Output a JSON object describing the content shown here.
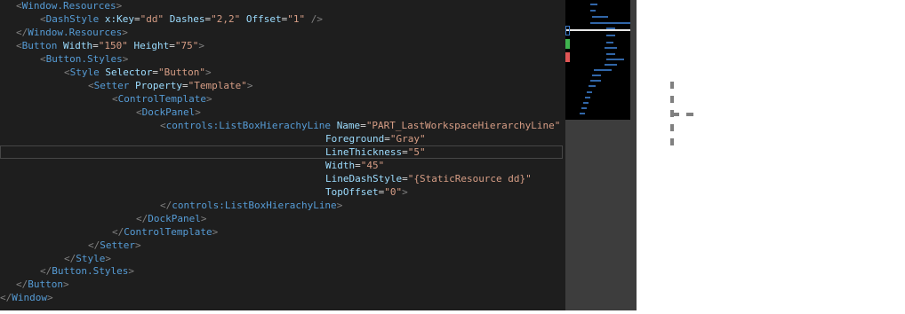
{
  "editor": {
    "lines": [
      {
        "parts": [
          {
            "c": "t-punc",
            "t": "<"
          },
          {
            "c": "t-tag",
            "t": "Window.Resources"
          },
          {
            "c": "t-punc",
            "t": ">"
          }
        ]
      },
      {
        "parts": [
          {
            "c": "t-punc",
            "t": "<"
          },
          {
            "c": "t-tag",
            "t": "DashStyle"
          },
          {
            "c": "t-eq",
            "t": " "
          },
          {
            "c": "t-attr",
            "t": "x:Key"
          },
          {
            "c": "t-eq",
            "t": "="
          },
          {
            "c": "t-val",
            "t": "\"dd\""
          },
          {
            "c": "t-eq",
            "t": " "
          },
          {
            "c": "t-attr",
            "t": "Dashes"
          },
          {
            "c": "t-eq",
            "t": "="
          },
          {
            "c": "t-val",
            "t": "\"2,2\""
          },
          {
            "c": "t-eq",
            "t": " "
          },
          {
            "c": "t-attr",
            "t": "Offset"
          },
          {
            "c": "t-eq",
            "t": "="
          },
          {
            "c": "t-val",
            "t": "\"1\""
          },
          {
            "c": "t-eq",
            "t": " "
          },
          {
            "c": "t-punc",
            "t": "/>"
          }
        ]
      },
      {
        "parts": [
          {
            "c": "t-punc",
            "t": "</"
          },
          {
            "c": "t-tag",
            "t": "Window.Resources"
          },
          {
            "c": "t-punc",
            "t": ">"
          }
        ]
      },
      {
        "parts": [
          {
            "c": "t-punc",
            "t": "<"
          },
          {
            "c": "t-tag",
            "t": "Button"
          },
          {
            "c": "t-eq",
            "t": " "
          },
          {
            "c": "t-attr",
            "t": "Width"
          },
          {
            "c": "t-eq",
            "t": "="
          },
          {
            "c": "t-val",
            "t": "\"150\""
          },
          {
            "c": "t-eq",
            "t": " "
          },
          {
            "c": "t-attr",
            "t": "Height"
          },
          {
            "c": "t-eq",
            "t": "="
          },
          {
            "c": "t-val",
            "t": "\"75\""
          },
          {
            "c": "t-punc",
            "t": ">"
          }
        ]
      },
      {
        "parts": [
          {
            "c": "t-punc",
            "t": "<"
          },
          {
            "c": "t-tag",
            "t": "Button.Styles"
          },
          {
            "c": "t-punc",
            "t": ">"
          }
        ]
      },
      {
        "parts": [
          {
            "c": "t-punc",
            "t": "<"
          },
          {
            "c": "t-tag",
            "t": "Style"
          },
          {
            "c": "t-eq",
            "t": " "
          },
          {
            "c": "t-attr",
            "t": "Selector"
          },
          {
            "c": "t-eq",
            "t": "="
          },
          {
            "c": "t-val",
            "t": "\"Button\""
          },
          {
            "c": "t-punc",
            "t": ">"
          }
        ]
      },
      {
        "parts": [
          {
            "c": "t-punc",
            "t": "<"
          },
          {
            "c": "t-tag",
            "t": "Setter"
          },
          {
            "c": "t-eq",
            "t": " "
          },
          {
            "c": "t-attr",
            "t": "Property"
          },
          {
            "c": "t-eq",
            "t": "="
          },
          {
            "c": "t-val",
            "t": "\"Template\""
          },
          {
            "c": "t-punc",
            "t": ">"
          }
        ]
      },
      {
        "parts": [
          {
            "c": "t-punc",
            "t": "<"
          },
          {
            "c": "t-tag",
            "t": "ControlTemplate"
          },
          {
            "c": "t-punc",
            "t": ">"
          }
        ]
      },
      {
        "parts": [
          {
            "c": "t-punc",
            "t": "<"
          },
          {
            "c": "t-tag",
            "t": "DockPanel"
          },
          {
            "c": "t-punc",
            "t": ">"
          }
        ]
      },
      {
        "parts": [
          {
            "c": "t-punc",
            "t": "<"
          },
          {
            "c": "t-tag",
            "t": "controls:ListBoxHierachyLine"
          },
          {
            "c": "t-eq",
            "t": " "
          },
          {
            "c": "t-attr",
            "t": "Name"
          },
          {
            "c": "t-eq",
            "t": "="
          },
          {
            "c": "t-val",
            "t": "\"PART_LastWorkspaceHierarchyLine\""
          }
        ]
      },
      {
        "parts": [
          {
            "c": "t-attr",
            "t": "Foreground"
          },
          {
            "c": "t-eq",
            "t": "="
          },
          {
            "c": "t-val",
            "t": "\"Gray\""
          }
        ]
      },
      {
        "parts": [
          {
            "c": "t-attr",
            "t": "LineThickness"
          },
          {
            "c": "t-eq",
            "t": "="
          },
          {
            "c": "t-val",
            "t": "\"5\""
          }
        ]
      },
      {
        "parts": [
          {
            "c": "t-attr",
            "t": "Width"
          },
          {
            "c": "t-eq",
            "t": "="
          },
          {
            "c": "t-val",
            "t": "\"45\""
          }
        ]
      },
      {
        "parts": [
          {
            "c": "t-attr",
            "t": "LineDashStyle"
          },
          {
            "c": "t-eq",
            "t": "="
          },
          {
            "c": "t-val",
            "t": "\"{StaticResource dd}\""
          }
        ]
      },
      {
        "parts": [
          {
            "c": "t-attr",
            "t": "TopOffset"
          },
          {
            "c": "t-eq",
            "t": "="
          },
          {
            "c": "t-val",
            "t": "\"0\""
          },
          {
            "c": "t-punc",
            "t": ">"
          }
        ]
      },
      {
        "parts": [
          {
            "c": "t-punc",
            "t": "</"
          },
          {
            "c": "t-tag",
            "t": "controls:ListBoxHierachyLine"
          },
          {
            "c": "t-punc",
            "t": ">"
          }
        ]
      },
      {
        "parts": [
          {
            "c": "t-punc",
            "t": "</"
          },
          {
            "c": "t-tag",
            "t": "DockPanel"
          },
          {
            "c": "t-punc",
            "t": ">"
          }
        ]
      },
      {
        "parts": [
          {
            "c": "t-punc",
            "t": "</"
          },
          {
            "c": "t-tag",
            "t": "ControlTemplate"
          },
          {
            "c": "t-punc",
            "t": ">"
          }
        ]
      },
      {
        "parts": [
          {
            "c": "t-punc",
            "t": "</"
          },
          {
            "c": "t-tag",
            "t": "Setter"
          },
          {
            "c": "t-punc",
            "t": ">"
          }
        ]
      },
      {
        "parts": [
          {
            "c": "t-punc",
            "t": "</"
          },
          {
            "c": "t-tag",
            "t": "Style"
          },
          {
            "c": "t-punc",
            "t": ">"
          }
        ]
      },
      {
        "parts": [
          {
            "c": "t-punc",
            "t": "</"
          },
          {
            "c": "t-tag",
            "t": "Button.Styles"
          },
          {
            "c": "t-punc",
            "t": ">"
          }
        ]
      },
      {
        "parts": [
          {
            "c": "t-punc",
            "t": "</"
          },
          {
            "c": "t-tag",
            "t": "Button"
          },
          {
            "c": "t-punc",
            "t": ">"
          }
        ]
      },
      {
        "parts": [
          {
            "c": "t-punc",
            "t": "</"
          },
          {
            "c": "t-tag",
            "t": "Window"
          },
          {
            "c": "t-punc",
            "t": ">"
          }
        ]
      }
    ]
  },
  "colors": {
    "editor_bg": "#1e1e1e",
    "tag": "#569cd6",
    "attribute": "#9cdcfe",
    "value": "#d69d85",
    "punctuation": "#808080",
    "preview_line": "#808080"
  }
}
